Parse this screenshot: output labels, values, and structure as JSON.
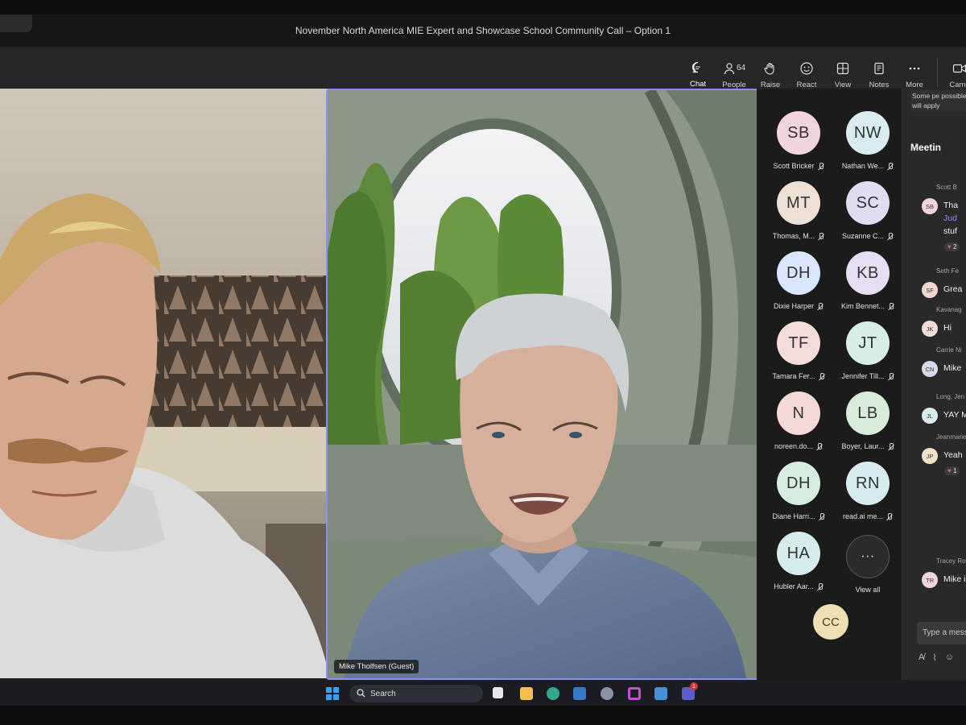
{
  "window": {
    "title": "November North America MIE Expert and Showcase School Community Call – Option 1"
  },
  "toolbar": {
    "chat": "Chat",
    "people": "People",
    "people_count": "64",
    "raise": "Raise",
    "react": "React",
    "view": "View",
    "notes": "Notes",
    "more": "More",
    "camera": "Came"
  },
  "stage": {
    "presenter_name": "Mike Tholfsen (Guest)"
  },
  "gallery": {
    "participants": [
      {
        "initials": "SB",
        "name": "Scott Bricker",
        "color": "#f0d6dc"
      },
      {
        "initials": "NW",
        "name": "Nathan We...",
        "color": "#d8ecf2"
      },
      {
        "initials": "MT",
        "name": "Thomas, M...",
        "color": "#efe0d6"
      },
      {
        "initials": "SC",
        "name": "Suzanne C...",
        "color": "#e0dcf2"
      },
      {
        "initials": "DH",
        "name": "Dixie Harper",
        "color": "#d9e6fb"
      },
      {
        "initials": "KB",
        "name": "Kim Bennet...",
        "color": "#e6def3"
      },
      {
        "initials": "TF",
        "name": "Tamara Fer...",
        "color": "#f4dcd8"
      },
      {
        "initials": "JT",
        "name": "Jennifer Till...",
        "color": "#d7ede7"
      },
      {
        "initials": "N",
        "name": "noreen.do...",
        "color": "#f5d9d5"
      },
      {
        "initials": "LB",
        "name": "Boyer, Laur...",
        "color": "#d8ecd9"
      },
      {
        "initials": "DH",
        "name": "Diane Harri...",
        "color": "#d6eddf"
      },
      {
        "initials": "RN",
        "name": "read.ai me...",
        "color": "#d6ecf0"
      },
      {
        "initials": "HA",
        "name": "Hubler Aar...",
        "color": "#d6ecec"
      }
    ],
    "view_all": "View all",
    "more_glyph": "···",
    "self_initials": "CC"
  },
  "chat": {
    "notice": "Some pe possible t will apply",
    "title": "Meetin",
    "messages": [
      {
        "sender": "Scott B",
        "initials": "SB",
        "text": "Tha",
        "extra": [
          "Jud",
          "stuf"
        ],
        "reaction": "2",
        "color": "#f0d6dc"
      },
      {
        "sender": "Seth Fe",
        "initials": "SF",
        "text": "Grea",
        "color": "#f3d8cf"
      },
      {
        "sender": "Kavanag",
        "initials": "JK",
        "text": "Hi",
        "color": "#f4dcd8"
      },
      {
        "sender": "Carrie Ni",
        "initials": "CN",
        "text": "Mike",
        "color": "#d9d9ee"
      },
      {
        "sender": "Long, Jen",
        "initials": "JL",
        "text": "YAY M",
        "color": "#d6ecec"
      },
      {
        "sender": "Jeanmarie",
        "initials": "JP",
        "text": "Yeah",
        "reaction": "1",
        "color": "#efe0c8"
      },
      {
        "sender": "Tracey Rowl",
        "initials": "TR",
        "text": "Mike is",
        "color": "#f0d6dc"
      }
    ],
    "compose_placeholder": "Type a mess"
  },
  "taskbar": {
    "search_label": "Search",
    "teams_badge": "1"
  }
}
